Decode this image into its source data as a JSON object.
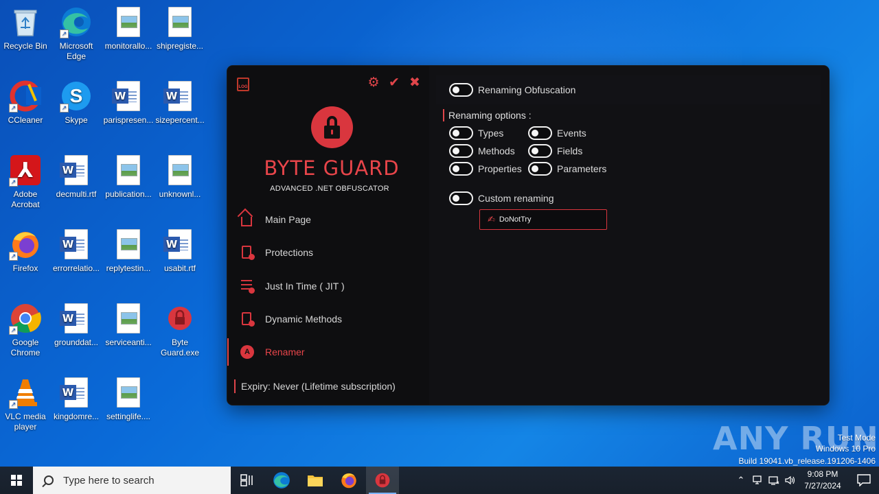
{
  "desktop": {
    "icons": [
      {
        "label": "Recycle Bin",
        "icon": "recycle-bin-icon"
      },
      {
        "label": "Microsoft Edge",
        "icon": "edge-icon"
      },
      {
        "label": "monitorallo...",
        "icon": "image-file-icon"
      },
      {
        "label": "shipregiste...",
        "icon": "image-file-icon"
      },
      {
        "label": "CCleaner",
        "icon": "ccleaner-icon"
      },
      {
        "label": "Skype",
        "icon": "skype-icon"
      },
      {
        "label": "parispresen...",
        "icon": "word-file-icon"
      },
      {
        "label": "sizepercent...",
        "icon": "word-file-icon"
      },
      {
        "label": "Adobe Acrobat",
        "icon": "acrobat-icon"
      },
      {
        "label": "decmulti.rtf",
        "icon": "word-file-icon"
      },
      {
        "label": "publication...",
        "icon": "image-file-icon"
      },
      {
        "label": "unknownl...",
        "icon": "image-file-icon"
      },
      {
        "label": "Firefox",
        "icon": "firefox-icon"
      },
      {
        "label": "errorrelatio...",
        "icon": "word-file-icon"
      },
      {
        "label": "replytestin...",
        "icon": "image-file-icon"
      },
      {
        "label": "usabit.rtf",
        "icon": "word-file-icon"
      },
      {
        "label": "Google Chrome",
        "icon": "chrome-icon"
      },
      {
        "label": "grounddat...",
        "icon": "word-file-icon"
      },
      {
        "label": "serviceanti...",
        "icon": "image-file-icon"
      },
      {
        "label": "Byte Guard.exe",
        "icon": "byte-guard-icon"
      },
      {
        "label": "VLC media player",
        "icon": "vlc-icon"
      },
      {
        "label": "kingdomre...",
        "icon": "word-file-icon"
      },
      {
        "label": "settinglife....",
        "icon": "image-file-icon"
      }
    ]
  },
  "app": {
    "log_label": "LOG",
    "brand_title": "BYTE GUARD",
    "brand_subtitle": "ADVANCED .NET OBFUSCATOR",
    "nav": [
      {
        "label": "Main Page",
        "icon": "home-icon"
      },
      {
        "label": "Protections",
        "icon": "file-shield-icon"
      },
      {
        "label": "Just In Time ( JIT )",
        "icon": "database-icon"
      },
      {
        "label": "Dynamic Methods",
        "icon": "document-icon"
      },
      {
        "label": "Renamer",
        "icon": "renamer-icon",
        "active": true
      }
    ],
    "expiry": "Expiry: Never (Lifetime subscription)",
    "renaming_obfuscation": "Renaming Obfuscation",
    "options_heading": "Renaming options :",
    "options": {
      "types": "Types",
      "methods": "Methods",
      "properties": "Properties",
      "events": "Events",
      "fields": "Fields",
      "parameters": "Parameters"
    },
    "custom_renaming": "Custom renaming",
    "custom_value": "DoNotTry",
    "accent_color": "#e0454a"
  },
  "watermark": {
    "brand": "ANY RUN",
    "line1": "Test Mode",
    "line2": "Windows 10 Pro",
    "line3": "Build 19041.vb_release.191206-1406"
  },
  "taskbar": {
    "search_placeholder": "Type here to search",
    "time": "9:08 PM",
    "date": "7/27/2024"
  }
}
